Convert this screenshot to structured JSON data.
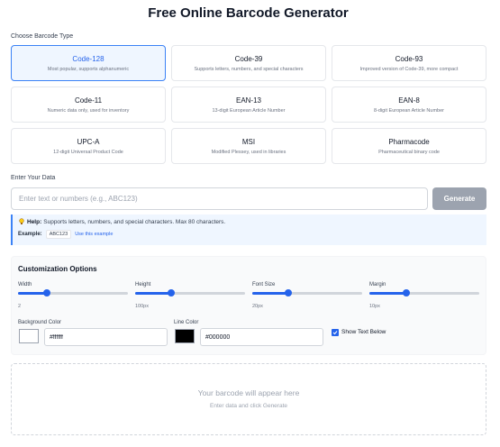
{
  "page": {
    "title": "Free Online Barcode Generator"
  },
  "barcode_types": {
    "label": "Choose Barcode Type",
    "selected": "Code-128",
    "items": [
      {
        "name": "Code-128",
        "desc": "Most popular, supports alphanumeric"
      },
      {
        "name": "Code-39",
        "desc": "Supports letters, numbers, and special characters"
      },
      {
        "name": "Code-93",
        "desc": "Improved version of Code-39, more compact"
      },
      {
        "name": "Code-11",
        "desc": "Numeric data only, used for inventory"
      },
      {
        "name": "EAN-13",
        "desc": "13-digit European Article Number"
      },
      {
        "name": "EAN-8",
        "desc": "8-digit European Article Number"
      },
      {
        "name": "UPC-A",
        "desc": "12-digit Universal Product Code"
      },
      {
        "name": "MSI",
        "desc": "Modified Plessey, used in libraries"
      },
      {
        "name": "Pharmacode",
        "desc": "Pharmaceutical binary code"
      }
    ]
  },
  "data_entry": {
    "label": "Enter Your Data",
    "placeholder": "Enter text or numbers (e.g., ABC123)",
    "value": "",
    "generate_label": "Generate"
  },
  "help": {
    "icon": "lightbulb-icon",
    "title": "Help:",
    "text": "Supports letters, numbers, and special characters. Max 80 characters.",
    "example_label": "Example:",
    "example_value": "ABC123",
    "use_example_label": "Use this example"
  },
  "customization": {
    "title": "Customization Options",
    "sliders": [
      {
        "label": "Width",
        "value_text": "2",
        "fraction": 0.26
      },
      {
        "label": "Height",
        "value_text": "100px",
        "fraction": 0.33
      },
      {
        "label": "Font Size",
        "value_text": "20px",
        "fraction": 0.33
      },
      {
        "label": "Margin",
        "value_text": "10px",
        "fraction": 0.34
      }
    ],
    "background_color": {
      "label": "Background Color",
      "value": "#ffffff"
    },
    "line_color": {
      "label": "Line Color",
      "value": "#000000"
    },
    "show_text": {
      "label": "Show Text Below",
      "checked": true
    }
  },
  "preview": {
    "title": "Your barcode will appear here",
    "subtitle": "Enter data and click Generate"
  },
  "colors": {
    "accent": "#2563eb",
    "selected_bg": "#eff6ff",
    "button_disabled": "#9ca3af"
  }
}
